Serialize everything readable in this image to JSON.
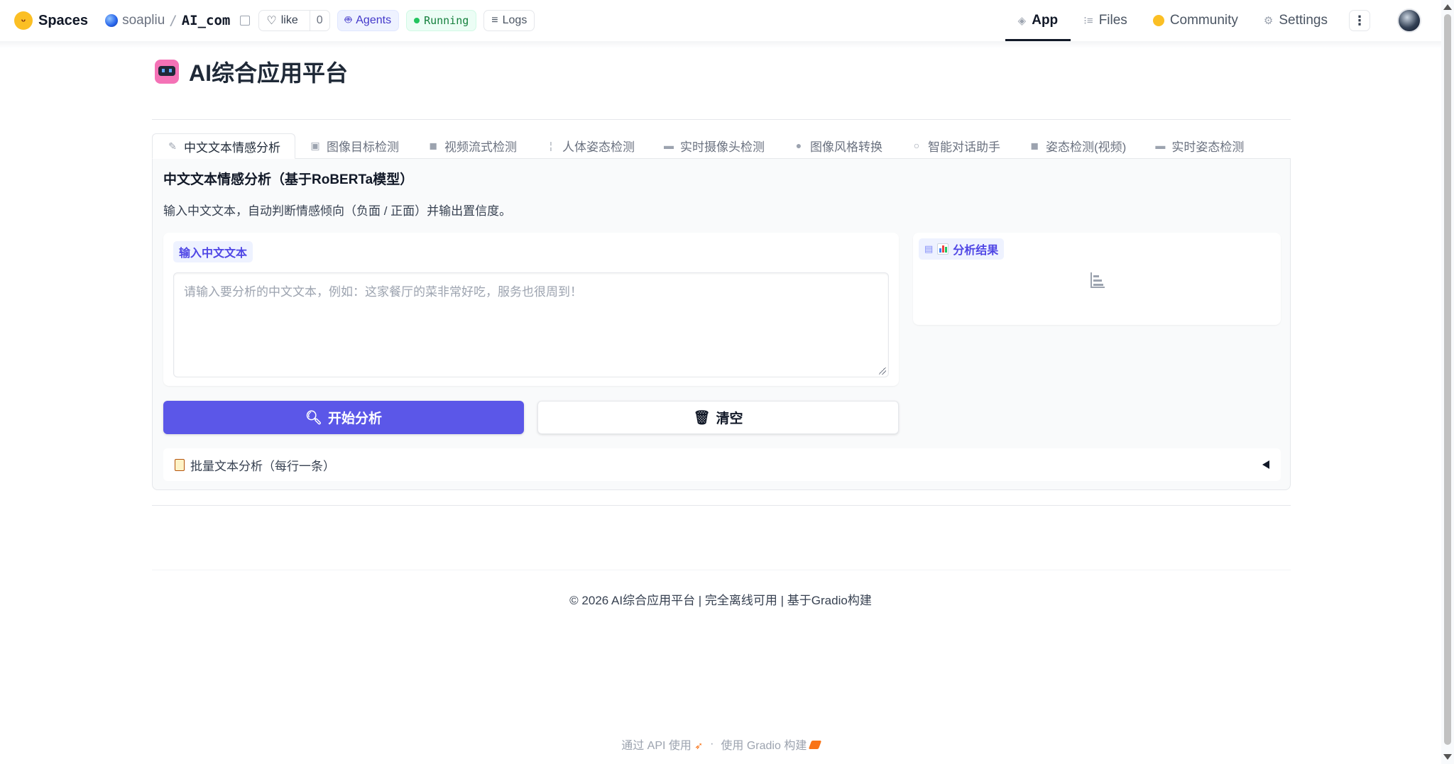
{
  "hf_header": {
    "brand": "Spaces",
    "owner": "soapliu",
    "slash": "/",
    "repo": "AI_com",
    "like_label": "like",
    "like_count": "0",
    "agents_label": "Agents",
    "status_label": "Running",
    "logs_label": "Logs",
    "nav": [
      {
        "label": "App",
        "icon": "cube-icon",
        "active": true
      },
      {
        "label": "Files",
        "icon": "files-icon",
        "active": false
      },
      {
        "label": "Community",
        "icon": "community-icon",
        "active": false
      },
      {
        "label": "Settings",
        "icon": "gear-icon",
        "active": false
      }
    ]
  },
  "app": {
    "title": "AI综合应用平台",
    "tabs": [
      {
        "label": "中文文本情感分析",
        "active": true
      },
      {
        "label": "图像目标检测",
        "active": false
      },
      {
        "label": "视频流式检测",
        "active": false
      },
      {
        "label": "人体姿态检测",
        "active": false
      },
      {
        "label": "实时摄像头检测",
        "active": false
      },
      {
        "label": "图像风格转换",
        "active": false
      },
      {
        "label": "智能对话助手",
        "active": false
      },
      {
        "label": "姿态检测(视频)",
        "active": false
      },
      {
        "label": "实时姿态检测",
        "active": false
      }
    ],
    "section_heading": "中文文本情感分析（基于RoBERTa模型）",
    "section_desc": "输入中文文本，自动判断情感倾向（负面 / 正面）并输出置信度。",
    "input_label": "输入中文文本",
    "input_placeholder": "请输入要分析的中文文本，例如：这家餐厅的菜非常好吃，服务也很周到！",
    "input_value": "",
    "output_label": "分析结果",
    "analyze_button": "开始分析",
    "clear_button": "清空",
    "batch_accordion": "批量文本分析（每行一条）",
    "footer": "© 2026 AI综合应用平台 | 完全离线可用 | 基于Gradio构建"
  },
  "gradio_footer": {
    "api_label": "通过 API 使用",
    "separator": "·",
    "built_label": "使用 Gradio 构建"
  },
  "colors": {
    "primary": "#5b57e8",
    "label_bg": "#eef2ff",
    "label_text": "#4f46e5",
    "running": "#22c55e"
  }
}
